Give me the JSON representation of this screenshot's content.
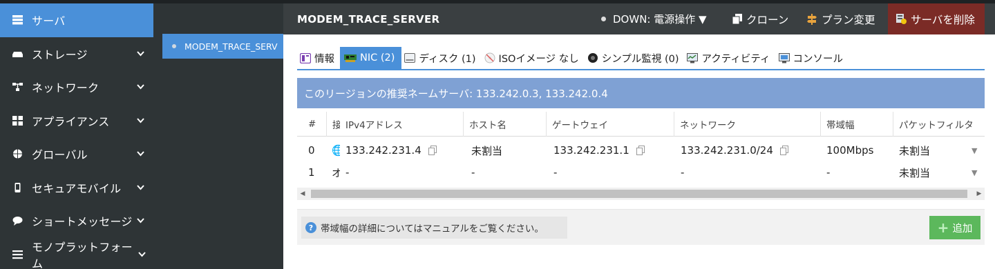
{
  "nav": {
    "items": [
      {
        "label": "サーバ",
        "icon": "server-icon",
        "active": true
      },
      {
        "label": "ストレージ",
        "icon": "storage-icon"
      },
      {
        "label": "ネットワーク",
        "icon": "network-icon"
      },
      {
        "label": "アプライアンス",
        "icon": "appliance-icon"
      },
      {
        "label": "グローバル",
        "icon": "globe-icon"
      },
      {
        "label": "セキュアモバイル",
        "icon": "mobile-icon"
      },
      {
        "label": "ショートメッセージ",
        "icon": "message-icon"
      },
      {
        "label": "モノプラットフォーム",
        "icon": "menu-icon"
      }
    ]
  },
  "server_list": {
    "selected": "MODEM_TRACE_SERV"
  },
  "header": {
    "server_name": "MODEM_TRACE_SERVER",
    "status": "DOWN: 電源操作 ▼",
    "clone": "クローン",
    "plan_change": "プラン変更",
    "delete": "サーバを削除"
  },
  "tabs": {
    "info": "情報",
    "nic": "NIC (2)",
    "disk": "ディスク (1)",
    "iso": "ISOイメージ なし",
    "monitor": "シンプル監視 (0)",
    "activity": "アクティビティ",
    "console": "コンソール"
  },
  "notice": "このリージョンの推奨ネームサーバ: 133.242.0.3, 133.242.0.4",
  "table": {
    "headers": {
      "num": "#",
      "conn": "接",
      "ipv4": "IPv4アドレス",
      "host": "ホスト名",
      "gateway": "ゲートウェイ",
      "network": "ネットワーク",
      "bandwidth": "帯域幅",
      "filter": "パケットフィルタ"
    },
    "rows": [
      {
        "num": "0",
        "conn": "🌐",
        "ipv4": "133.242.231.4",
        "host": "未割当",
        "gateway": "133.242.231.1",
        "network": "133.242.231.0/24",
        "bandwidth": "100Mbps",
        "filter": "未割当"
      },
      {
        "num": "1",
        "conn": "オ",
        "ipv4": "-",
        "host": "-",
        "gateway": "-",
        "network": "-",
        "bandwidth": "-",
        "filter": "未割当"
      }
    ]
  },
  "footer": {
    "help": "帯域幅の詳細についてはマニュアルをご覧ください。",
    "add": "追加"
  },
  "colors": {
    "accent": "#4a90d9",
    "nav_bg": "#2e3436",
    "header_bg": "#3a3f41",
    "delete_bg": "#7b2b26",
    "notice_bg": "#7fa1d4",
    "add_bg": "#5cb85c"
  }
}
